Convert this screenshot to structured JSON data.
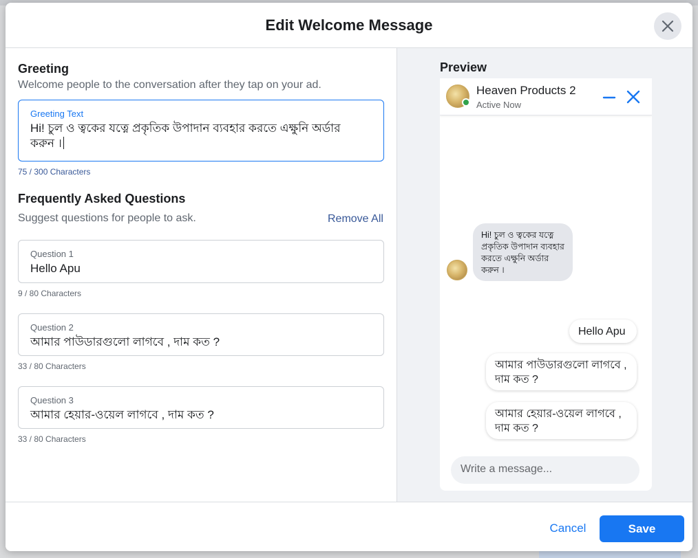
{
  "modal": {
    "title": "Edit Welcome Message"
  },
  "greeting": {
    "title": "Greeting",
    "subtitle": "Welcome people to the conversation after they tap on your ad.",
    "field_label": "Greeting Text",
    "value": "Hi! চুল ও ত্বকের যত্নে প্রকৃতিক উপাদান ব্যবহার করতে এক্ষুনি অর্ডার করুন ।",
    "char_count": "75 / 300 Characters"
  },
  "faq": {
    "title": "Frequently Asked Questions",
    "subtitle": "Suggest questions for people to ask.",
    "remove_all": "Remove All",
    "questions": [
      {
        "label": "Question 1",
        "value": "Hello Apu",
        "char_count": "9 / 80 Characters"
      },
      {
        "label": "Question 2",
        "value": "আমার পাউডারগুলো লাগবে ,  দাম কত ?",
        "char_count": "33 / 80 Characters"
      },
      {
        "label": "Question 3",
        "value": "আমার হেয়ার-ওয়েল লাগবে ,  দাম কত ?",
        "char_count": "33 / 80 Characters"
      }
    ]
  },
  "preview": {
    "title": "Preview",
    "page_name": "Heaven Products 2",
    "status": "Active Now",
    "greeting_bubble": "Hi! চুল ও ত্বকের যত্নে প্রকৃতিক উপাদান ব্যবহার করতে এক্ষুনি অর্ডার করুন ।",
    "quick_replies": [
      "Hello Apu",
      "আমার পাউডারগুলো লাগবে , দাম কত ?",
      "আমার হেয়ার-ওয়েল লাগবে , দাম কত ?"
    ],
    "composer_placeholder": "Write a message..."
  },
  "footer": {
    "cancel_label": "Cancel",
    "save_label": "Save"
  },
  "colors": {
    "accent": "#1877f2",
    "link": "#385898",
    "online": "#31a24c",
    "preview_bg": "#f0f2f5"
  }
}
